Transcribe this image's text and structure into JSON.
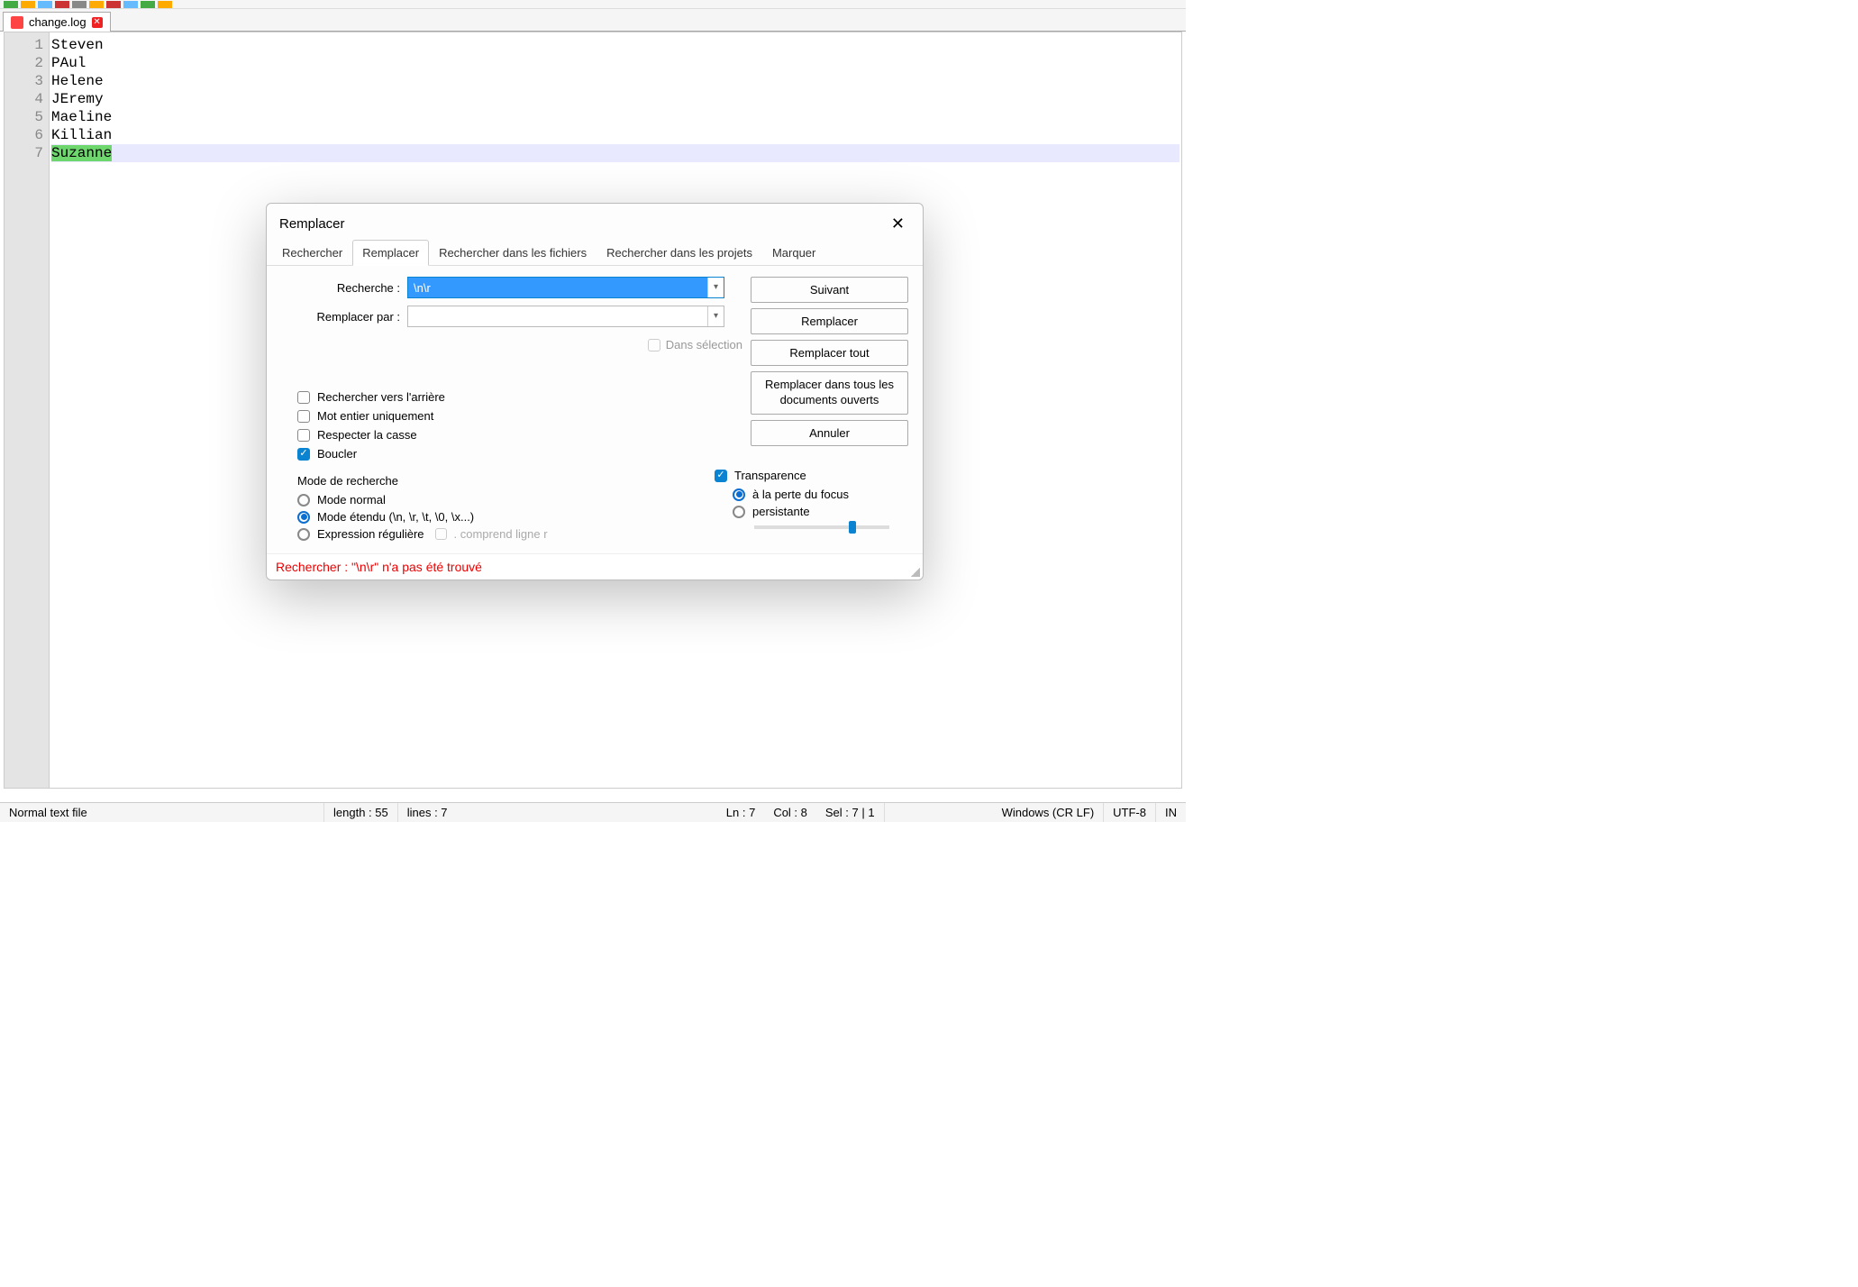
{
  "tab": {
    "filename": "change.log"
  },
  "editor": {
    "lines": [
      "Steven",
      "PAul",
      "Helene",
      "JEremy",
      "Maeline",
      "Killian",
      "Suzanne"
    ],
    "line_numbers": [
      "1",
      "2",
      "3",
      "4",
      "5",
      "6",
      "7"
    ]
  },
  "dialog": {
    "title": "Remplacer",
    "tabs": {
      "search": "Rechercher",
      "replace": "Remplacer",
      "in_files": "Rechercher dans les fichiers",
      "in_projects": "Rechercher dans les projets",
      "mark": "Marquer"
    },
    "labels": {
      "search": "Recherche :",
      "replace_with": "Remplacer par :",
      "in_selection": "Dans sélection"
    },
    "fields": {
      "search_value": "\\n\\r",
      "replace_value": ""
    },
    "buttons": {
      "next": "Suivant",
      "replace": "Remplacer",
      "replace_all": "Remplacer tout",
      "replace_all_docs": "Remplacer dans tous les documents ouverts",
      "cancel": "Annuler"
    },
    "options": {
      "backward": "Rechercher vers l'arrière",
      "whole_word": "Mot entier uniquement",
      "match_case": "Respecter la casse",
      "wrap": "Boucler"
    },
    "mode": {
      "title": "Mode de recherche",
      "normal": "Mode normal",
      "extended": "Mode étendu (\\n, \\r, \\t, \\0, \\x...)",
      "regex": "Expression régulière",
      "regex_extra": ". comprend ligne r"
    },
    "transparency": {
      "label": "Transparence",
      "on_blur": "à la perte du focus",
      "persistent": "persistante"
    },
    "status": "Rechercher : \"\\n\\r\" n'a pas été trouvé"
  },
  "statusbar": {
    "filetype": "Normal text file",
    "length": "length : 55",
    "lines": "lines : 7",
    "ln": "Ln : 7",
    "col": "Col : 8",
    "sel": "Sel : 7 | 1",
    "eol": "Windows (CR LF)",
    "encoding": "UTF-8",
    "mode": "IN"
  }
}
